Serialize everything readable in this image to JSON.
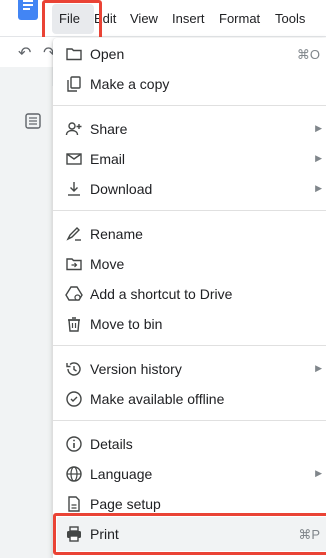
{
  "menubar": {
    "items": [
      "File",
      "Edit",
      "View",
      "Insert",
      "Format",
      "Tools"
    ]
  },
  "file_menu": {
    "items": [
      {
        "label": "Open",
        "icon": "folder-icon",
        "shortcut": "⌘O"
      },
      {
        "label": "Make a copy",
        "icon": "copy-icon"
      },
      {
        "label": "Share",
        "icon": "person-add-icon",
        "submenu": true
      },
      {
        "label": "Email",
        "icon": "email-icon",
        "submenu": true
      },
      {
        "label": "Download",
        "icon": "download-icon",
        "submenu": true
      },
      {
        "label": "Rename",
        "icon": "rename-icon"
      },
      {
        "label": "Move",
        "icon": "move-folder-icon"
      },
      {
        "label": "Add a shortcut to Drive",
        "icon": "drive-shortcut-icon"
      },
      {
        "label": "Move to bin",
        "icon": "trash-icon"
      },
      {
        "label": "Version history",
        "icon": "history-icon",
        "submenu": true
      },
      {
        "label": "Make available offline",
        "icon": "offline-icon"
      },
      {
        "label": "Details",
        "icon": "info-icon"
      },
      {
        "label": "Language",
        "icon": "globe-icon",
        "submenu": true
      },
      {
        "label": "Page setup",
        "icon": "page-setup-icon"
      },
      {
        "label": "Print",
        "icon": "printer-icon",
        "shortcut": "⌘P"
      }
    ]
  },
  "colors": {
    "highlight": "#ea4335",
    "docs_blue": "#4285f4"
  }
}
